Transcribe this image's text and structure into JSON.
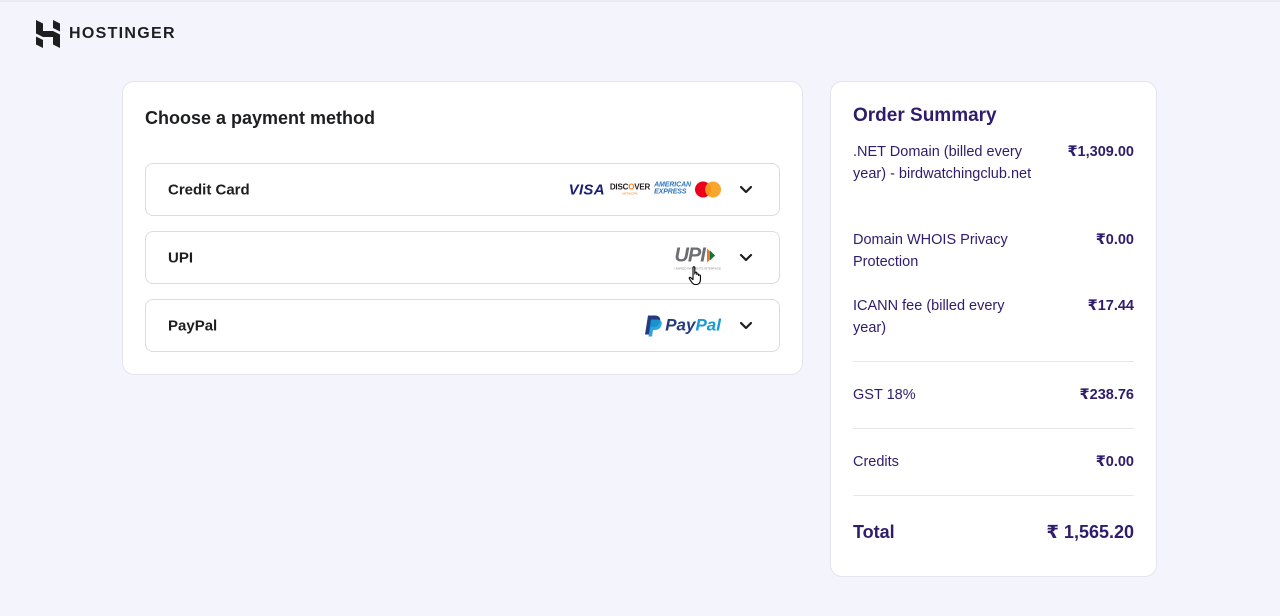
{
  "brand": {
    "name": "HOSTINGER"
  },
  "payment": {
    "title": "Choose a payment method",
    "methods": [
      {
        "label": "Credit Card",
        "logos": [
          "visa",
          "discover",
          "american-express",
          "mastercard"
        ]
      },
      {
        "label": "UPI",
        "logos": [
          "upi"
        ]
      },
      {
        "label": "PayPal",
        "logos": [
          "paypal"
        ]
      }
    ],
    "card_logos": {
      "visa": "VISA",
      "discover": "DISC",
      "discover_o": "O",
      "discover_end": "VER",
      "discover_sub": "NETWORK",
      "amex_line1": "AMERICAN",
      "amex_line2": "EXPRESS"
    },
    "upi_logo": {
      "text": "UPI",
      "sub": "UNIFIED PAYMENTS INTERFACE"
    },
    "paypal_logo": {
      "pay": "Pay",
      "pal": "Pal"
    }
  },
  "summary": {
    "title": "Order Summary",
    "items": [
      {
        "label": ".NET Domain (billed every year) - birdwatchingclub.net",
        "price": "₹1,309.00"
      },
      {
        "label": "Domain WHOIS Privacy Protection",
        "price": "₹0.00"
      },
      {
        "label": "ICANN fee (billed every year)",
        "price": "₹17.44"
      },
      {
        "label": "GST 18%",
        "price": "₹238.76"
      },
      {
        "label": "Credits",
        "price": "₹0.00"
      }
    ],
    "total_label": "Total",
    "total_value": "₹ 1,565.20"
  },
  "colors": {
    "background": "#f4f5fc",
    "heading": "#2f1c6a",
    "visa": "#1a1f71",
    "paypal_dark": "#253b80",
    "paypal_light": "#179bd7",
    "mastercard_red": "#eb001b",
    "mastercard_orange": "#f79e1b"
  }
}
